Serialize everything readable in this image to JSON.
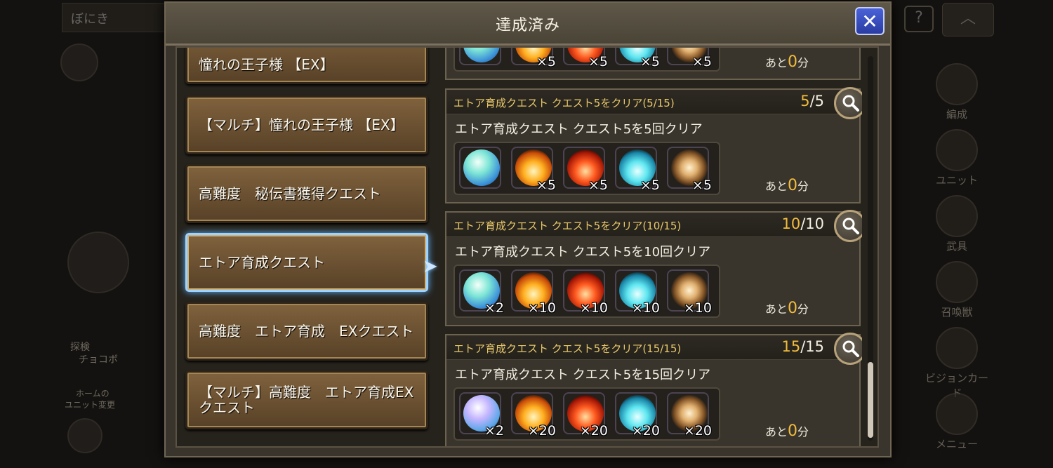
{
  "background": {
    "top_left_label": "ぼにき",
    "help_icon": "question-icon",
    "up_icon": "chevron-up-icon",
    "left_labels": [
      "探検",
      "チョコボ",
      "ホームの",
      "ユニット変更"
    ],
    "right_menu": [
      "編成",
      "ユニット",
      "武具",
      "召喚獣",
      "ビジョンカード",
      "メニュー"
    ]
  },
  "dialog": {
    "title": "達成済み",
    "close_icon": "close-icon"
  },
  "quest_list": [
    {
      "label": "憧れの王子様 【EX】"
    },
    {
      "label": "【マルチ】憧れの王子様 【EX】"
    },
    {
      "label": "高難度　秘伝書獲得クエスト"
    },
    {
      "label": "エトア育成クエスト",
      "selected": true
    },
    {
      "label": "高難度　エトア育成　EXクエスト"
    },
    {
      "label": "【マルチ】高難度　エトア育成EXクエスト"
    }
  ],
  "achievements": [
    {
      "title": "",
      "progress_current": "",
      "progress_total": "",
      "description": "",
      "rewards": [
        {
          "icon": "ball",
          "count": ""
        },
        {
          "icon": "fire",
          "count": "×5"
        },
        {
          "icon": "red",
          "count": "×5"
        },
        {
          "icon": "ice",
          "count": "×5"
        },
        {
          "icon": "ore",
          "count": "×5"
        }
      ],
      "remain_prefix": "あと",
      "remain_value": "0",
      "remain_unit": "分"
    },
    {
      "title": "エトア育成クエスト クエスト5をクリア(5/15)",
      "progress_current": "5",
      "progress_total": "/5",
      "description": "エトア育成クエスト クエスト5を5回クリア",
      "rewards": [
        {
          "icon": "ball",
          "count": ""
        },
        {
          "icon": "fire",
          "count": "×5"
        },
        {
          "icon": "red",
          "count": "×5"
        },
        {
          "icon": "ice",
          "count": "×5"
        },
        {
          "icon": "ore",
          "count": "×5"
        }
      ],
      "remain_prefix": "あと",
      "remain_value": "0",
      "remain_unit": "分"
    },
    {
      "title": "エトア育成クエスト クエスト5をクリア(10/15)",
      "progress_current": "10",
      "progress_total": "/10",
      "description": "エトア育成クエスト クエスト5を10回クリア",
      "rewards": [
        {
          "icon": "ball",
          "count": "×2"
        },
        {
          "icon": "fire",
          "count": "×10"
        },
        {
          "icon": "red",
          "count": "×10"
        },
        {
          "icon": "ice",
          "count": "×10"
        },
        {
          "icon": "ore",
          "count": "×10"
        }
      ],
      "remain_prefix": "あと",
      "remain_value": "0",
      "remain_unit": "分"
    },
    {
      "title": "エトア育成クエスト クエスト5をクリア(15/15)",
      "progress_current": "15",
      "progress_total": "/15",
      "description": "エトア育成クエスト クエスト5を15回クリア",
      "rewards": [
        {
          "icon": "ball2",
          "count": "×2"
        },
        {
          "icon": "fire",
          "count": "×20"
        },
        {
          "icon": "red",
          "count": "×20"
        },
        {
          "icon": "ice",
          "count": "×20"
        },
        {
          "icon": "ore",
          "count": "×20"
        }
      ],
      "remain_prefix": "あと",
      "remain_value": "0",
      "remain_unit": "分"
    }
  ],
  "colors": {
    "accent_gold": "#f3bd3c",
    "title_yellow": "#e9c96b",
    "close_blue": "#2a3ca3",
    "selected_glow": "#9fd3ff"
  }
}
